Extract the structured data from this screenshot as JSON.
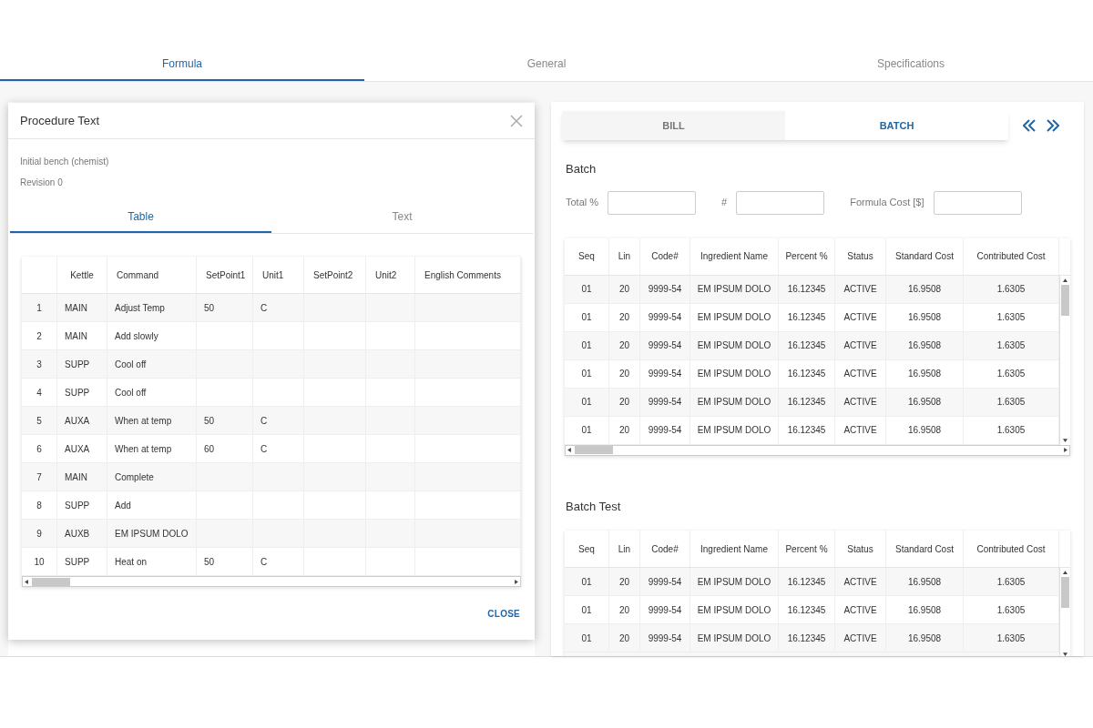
{
  "tabs": [
    {
      "label": "Formula",
      "selected": true
    },
    {
      "label": "General",
      "selected": false
    },
    {
      "label": "Specifications",
      "selected": false
    }
  ],
  "dialog": {
    "title": "Procedure Text",
    "lines": [
      "Initial bench (chemist)",
      "Revision 0"
    ],
    "tabs": [
      {
        "label": "Table",
        "selected": true
      },
      {
        "label": "Text",
        "selected": false
      }
    ],
    "table": {
      "columns": [
        "",
        "Kettle",
        "Command",
        "SetPoint1",
        "Unit1",
        "SetPoint2",
        "Unit2",
        "English Comments"
      ],
      "rows": [
        [
          "1",
          "MAIN",
          "Adjust Temp",
          "50",
          "C",
          "",
          "",
          ""
        ],
        [
          "2",
          "MAIN",
          "Add slowly",
          "",
          "",
          "",
          "",
          ""
        ],
        [
          "3",
          "SUPP",
          "Cool off",
          "",
          "",
          "",
          "",
          ""
        ],
        [
          "4",
          "SUPP",
          "Cool off",
          "",
          "",
          "",
          "",
          ""
        ],
        [
          "5",
          "AUXA",
          "When at temp",
          "50",
          "C",
          "",
          "",
          ""
        ],
        [
          "6",
          "AUXA",
          "When at temp",
          "60",
          "C",
          "",
          "",
          ""
        ],
        [
          "7",
          "MAIN",
          "Complete",
          "",
          "",
          "",
          "",
          ""
        ],
        [
          "8",
          "SUPP",
          "Add",
          "",
          "",
          "",
          "",
          ""
        ],
        [
          "9",
          "AUXB",
          "EM IPSUM DOLO",
          "",
          "",
          "",
          "",
          ""
        ],
        [
          "10",
          "SUPP",
          "Heat on",
          "50",
          "C",
          "",
          "",
          ""
        ]
      ]
    },
    "close_button": "CLOSE"
  },
  "right_panel": {
    "segments": [
      {
        "label": "BILL",
        "selected": false
      },
      {
        "label": "BATCH",
        "selected": true
      }
    ],
    "batch": {
      "title": "Batch",
      "fields": [
        {
          "label": "Total %"
        },
        {
          "label": "#"
        },
        {
          "label": "Formula Cost [$]"
        }
      ],
      "table": {
        "columns": [
          "Seq",
          "Lin",
          "Code#",
          "Ingredient Name",
          "Percent %",
          "Status",
          "Standard Cost",
          "Contributed Cost"
        ],
        "rows": [
          [
            "01",
            "20",
            "9999-54",
            "EM IPSUM DOLO",
            "16.12345",
            "ACTIVE",
            "16.9508",
            "1.6305"
          ],
          [
            "01",
            "20",
            "9999-54",
            "EM IPSUM DOLO",
            "16.12345",
            "ACTIVE",
            "16.9508",
            "1.6305"
          ],
          [
            "01",
            "20",
            "9999-54",
            "EM IPSUM DOLO",
            "16.12345",
            "ACTIVE",
            "16.9508",
            "1.6305"
          ],
          [
            "01",
            "20",
            "9999-54",
            "EM IPSUM DOLO",
            "16.12345",
            "ACTIVE",
            "16.9508",
            "1.6305"
          ],
          [
            "01",
            "20",
            "9999-54",
            "EM IPSUM DOLO",
            "16.12345",
            "ACTIVE",
            "16.9508",
            "1.6305"
          ],
          [
            "01",
            "20",
            "9999-54",
            "EM IPSUM DOLO",
            "16.12345",
            "ACTIVE",
            "16.9508",
            "1.6305"
          ]
        ]
      }
    },
    "batch_test": {
      "title": "Batch Test",
      "table": {
        "columns": [
          "Seq",
          "Lin",
          "Code#",
          "Ingredient Name",
          "Percent %",
          "Status",
          "Standard Cost",
          "Contributed Cost"
        ],
        "rows": [
          [
            "01",
            "20",
            "9999-54",
            "EM IPSUM DOLO",
            "16.12345",
            "ACTIVE",
            "16.9508",
            "1.6305"
          ],
          [
            "01",
            "20",
            "9999-54",
            "EM IPSUM DOLO",
            "16.12345",
            "ACTIVE",
            "16.9508",
            "1.6305"
          ],
          [
            "01",
            "20",
            "9999-54",
            "EM IPSUM DOLO",
            "16.12345",
            "ACTIVE",
            "16.9508",
            "1.6305"
          ]
        ]
      }
    }
  }
}
